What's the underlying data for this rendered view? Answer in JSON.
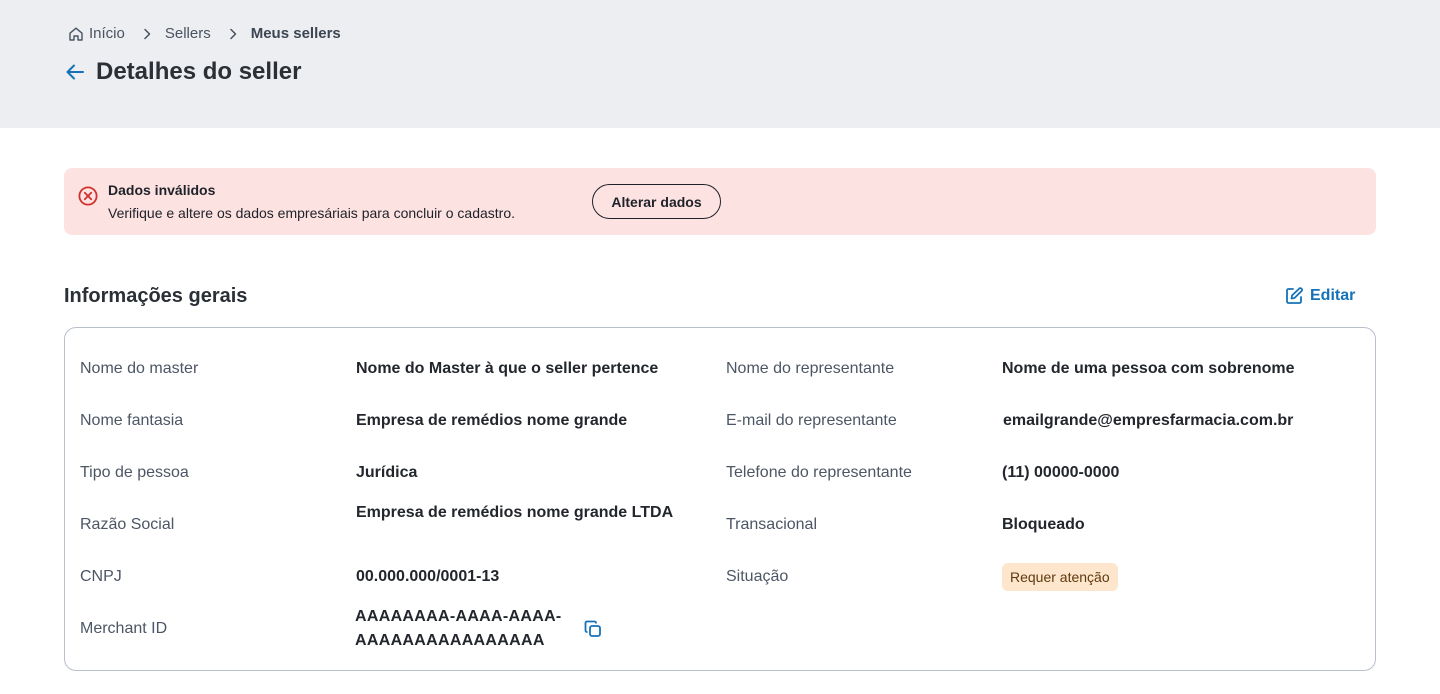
{
  "breadcrumb": {
    "home": "Início",
    "sellers": "Sellers",
    "current": "Meus sellers"
  },
  "page": {
    "title": "Detalhes do seller"
  },
  "alert": {
    "title": "Dados inválidos",
    "description": "Verifique e altere os dados empresáriais para concluir o cadastro.",
    "button": "Alterar dados"
  },
  "section": {
    "title": "Informações gerais",
    "edit_label": "Editar"
  },
  "details": {
    "left": [
      {
        "label": "Nome do master",
        "value": "Nome do Master à que o seller pertence"
      },
      {
        "label": "Nome fantasia",
        "value": "Empresa de remédios nome grande"
      },
      {
        "label": "Tipo de pessoa",
        "value": "Jurídica"
      },
      {
        "label": "Razão Social",
        "value": "Empresa de remédios nome grande LTDA"
      },
      {
        "label": "CNPJ",
        "value": "00.000.000/0001-13"
      },
      {
        "label": "Merchant ID",
        "value": "AAAAAAAA-AAAA-AAAA-AAAAAAAAAAAAAAAA"
      }
    ],
    "right": [
      {
        "label": "Nome do representante",
        "value": "Nome de uma pessoa com sobrenome"
      },
      {
        "label": "E-mail do representante",
        "value": "emailgrande@empresfarmacia.com.br"
      },
      {
        "label": "Telefone do representante",
        "value": "(11) 00000-0000"
      },
      {
        "label": "Transacional",
        "value": "Bloqueado"
      },
      {
        "label": "Situação",
        "value": "Requer atenção"
      }
    ]
  },
  "colors": {
    "accent": "#1572b9",
    "alert_bg": "#fde2e2",
    "alert_icon": "#d0312d",
    "badge_bg": "#fde6cc",
    "header_bg": "#eceef1"
  },
  "icons": {
    "home": "home-icon",
    "separator": "chevron-right-icon",
    "back": "arrow-left-icon",
    "alert": "x-circle-icon",
    "edit": "edit-icon",
    "copy": "copy-icon"
  }
}
